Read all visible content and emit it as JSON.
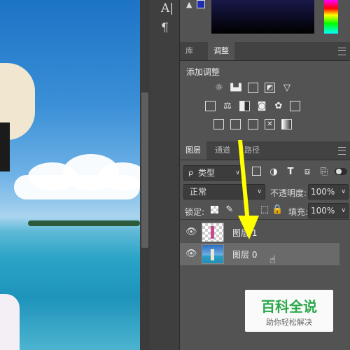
{
  "left_tools": {
    "type_tool_glyph": "A|",
    "paragraph_glyph": "¶"
  },
  "top_panel": {
    "warning_glyph": "▲"
  },
  "adjustments_panel": {
    "tabs": [
      "库",
      "调整"
    ],
    "active_tab": "调整",
    "heading": "添加调整"
  },
  "layers_panel": {
    "tabs": [
      "图层",
      "通道",
      "路径"
    ],
    "active_tab": "图层",
    "filter_label": "类型",
    "filter_glyph": "ρ",
    "blend_mode": "正常",
    "opacity_label": "不透明度:",
    "opacity_value": "100%",
    "lock_label": "锁定:",
    "fill_label": "填充:",
    "fill_value": "100%",
    "layers": [
      {
        "name": "图层 1",
        "visible": true,
        "selected": false
      },
      {
        "name": "图层 0",
        "visible": true,
        "selected": true
      }
    ]
  },
  "watermark": {
    "title": "百科全说",
    "subtitle": "助你轻松解决"
  },
  "colors": {
    "annotation_arrow": "#ffff00",
    "watermark_green": "#2aa84a",
    "panel_bg": "#535353"
  }
}
